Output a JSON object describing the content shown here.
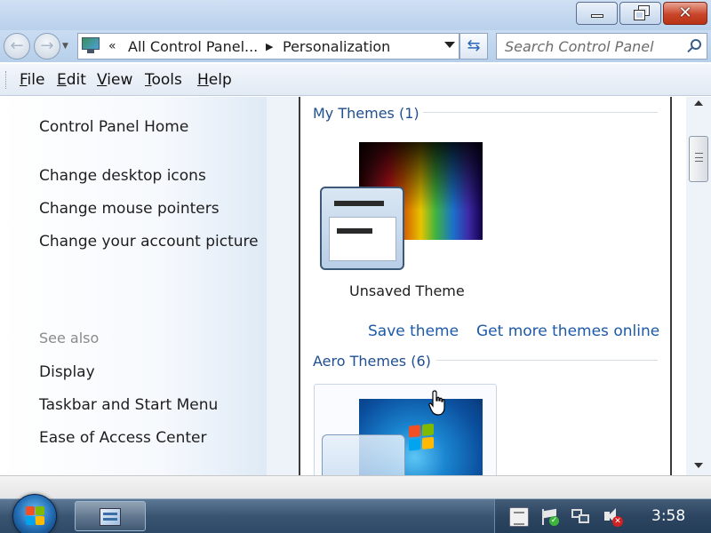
{
  "window": {
    "minimize_label": "",
    "close_glyph": "✕"
  },
  "navigation": {
    "back_glyph": "←",
    "forward_glyph": "→",
    "breadcrumb_chevron": "«",
    "breadcrumb_items": [
      "All Control Panel...",
      "Personalization"
    ],
    "breadcrumb_separator": "▶",
    "refresh_glyph": "⇆",
    "search_placeholder": "Search Control Panel"
  },
  "menu": {
    "items": [
      {
        "label": "File",
        "accel": "F",
        "rest": "ile"
      },
      {
        "label": "Edit",
        "accel": "E",
        "rest": "dit"
      },
      {
        "label": "View",
        "accel": "V",
        "rest": "iew"
      },
      {
        "label": "Tools",
        "accel": "T",
        "rest": "ools"
      },
      {
        "label": "Help",
        "accel": "H",
        "rest": "elp"
      }
    ]
  },
  "left_pane": {
    "home_link": "Control Panel Home",
    "tasks": [
      "Change desktop icons",
      "Change mouse pointers",
      "Change your account picture"
    ],
    "see_also_heading": "See also",
    "see_also_links": [
      "Display",
      "Taskbar and Start Menu",
      "Ease of Access Center"
    ]
  },
  "main": {
    "my_themes_heading": "My Themes (1)",
    "unsaved_theme_name": "Unsaved Theme",
    "save_theme_link": "Save theme",
    "get_more_link": "Get more themes online",
    "aero_themes_heading": "Aero Themes (6)"
  },
  "taskbar": {
    "clock": "3:58",
    "tray_ok_glyph": "✓",
    "tray_mute_glyph": "✕"
  },
  "icons": {
    "address": "control-panel-icon",
    "search": "search-icon",
    "tray": [
      "action-center-note-icon",
      "flag-icon",
      "network-icon",
      "volume-muted-icon"
    ]
  },
  "colors": {
    "link": "#1c5aa8",
    "heading": "#1f4f8f",
    "close_button": "#c9452a",
    "taskbar": "#3a5572"
  }
}
